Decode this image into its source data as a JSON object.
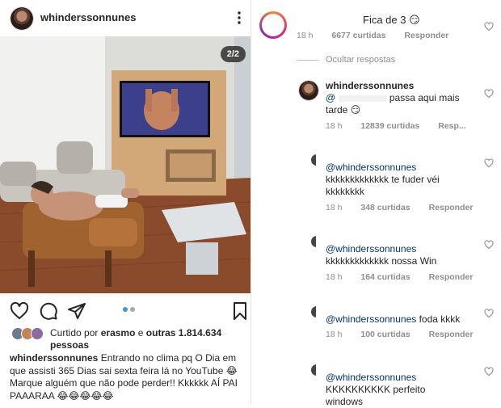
{
  "post": {
    "username": "whinderssonnunes",
    "image_counter": "2/2",
    "liked_prefix": "Curtido por",
    "liked_user": "erasmo",
    "liked_middle": "e",
    "liked_count": "outras 1.814.634 pessoas",
    "caption_user": "whinderssonnunes",
    "caption_text": "Entrando no clima pq O Dia em que assisti 365 Dias sai sexta feira lá no YouTube 😂 Marque alguém que não pode perder!! Kkkkkk AÍ PAI PAAARAA 😂😂😂😂😂"
  },
  "comments": {
    "top": {
      "text": "Fica de 3 😏",
      "time": "18 h",
      "likes": "6677 curtidas",
      "reply": "Responder"
    },
    "hide_replies": "Ocultar respostas",
    "replies": [
      {
        "username": "whinderssonnunes",
        "mention": "@",
        "text": "passa aqui mais tarde 😏",
        "time": "18 h",
        "likes": "12839 curtidas",
        "reply": "Resp..."
      },
      {
        "mention": "@whinderssonnunes",
        "text": "kkkkkkkkkkkkk te fuder véi kkkkkkkk",
        "time": "18 h",
        "likes": "348 curtidas",
        "reply": "Responder"
      },
      {
        "mention": "@whinderssonnunes",
        "text": "kkkkkkkkkkkkk nossa Win",
        "time": "18 h",
        "likes": "164 curtidas",
        "reply": "Responder"
      },
      {
        "mention": "@whinderssonnunes",
        "text": "foda kkkk",
        "time": "18 h",
        "likes": "100 curtidas",
        "reply": "Responder"
      },
      {
        "mention": "@whinderssonnunes",
        "text": "KKKKKKKKKK perfeito windows"
      }
    ]
  },
  "icons": {
    "more": "more-vertical-icon",
    "heart": "heart-icon",
    "comment": "comment-icon",
    "share": "share-icon",
    "bookmark": "bookmark-icon",
    "like_small": "heart-small-icon"
  },
  "colors": {
    "text": "#262626",
    "muted": "#8e8e8e",
    "link": "#00376b",
    "dot_active": "#3897f0"
  }
}
